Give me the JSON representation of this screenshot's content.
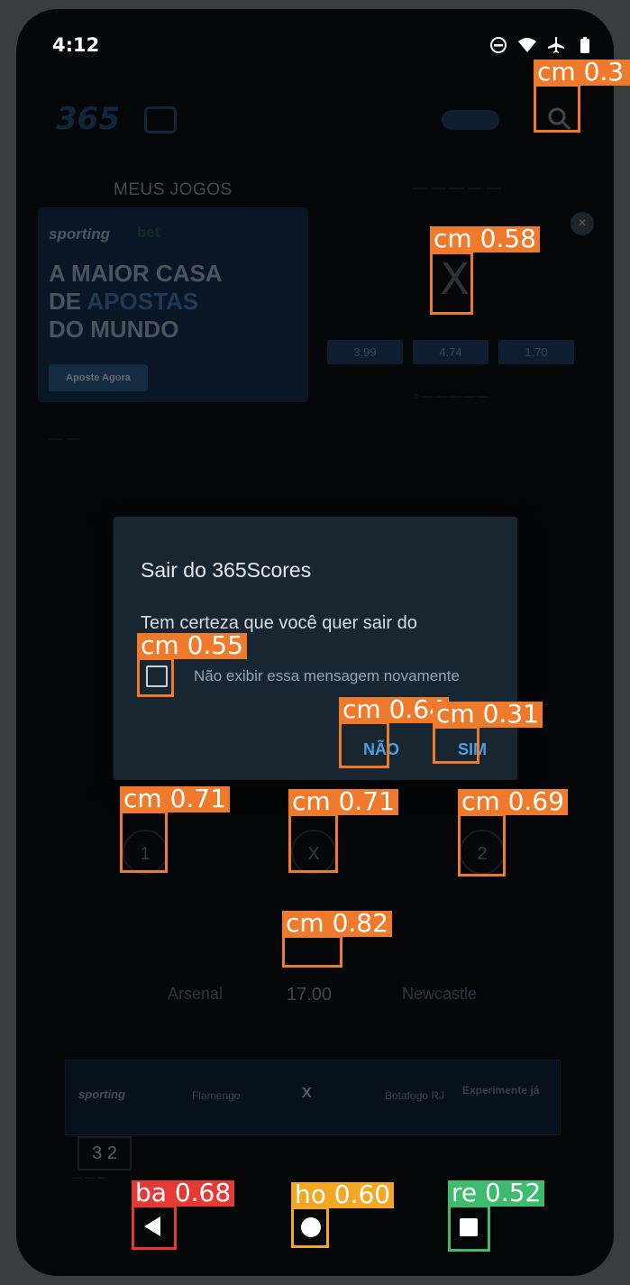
{
  "status_bar": {
    "time": "4:12"
  },
  "app": {
    "logo": "365",
    "tab_my_games": "MEUS JOGOS",
    "banner": {
      "brand": "sporting",
      "brand_suffix": "bet",
      "headline_line1": "A MAIOR CASA",
      "headline_line2a": "DE ",
      "headline_line2b": "APOSTAS",
      "headline_line3": "DO MUNDO",
      "cta": "Aposte Agora"
    },
    "close_ad": "×",
    "odds_x": "X",
    "odds": [
      "3.99",
      "4.74",
      "1.70"
    ],
    "prediction": {
      "home": "1",
      "draw": "X",
      "away": "2"
    },
    "match": {
      "home": "Arsenal",
      "away": "Newcastle",
      "time": "17.00"
    },
    "ad2": {
      "brand": "sporting",
      "home": "Flamengo",
      "vs": "X",
      "away": "Botafogo RJ",
      "cta": "Experimente já"
    },
    "score": "3 2"
  },
  "dialog": {
    "title": "Sair do 365Scores",
    "message": "Tem certeza que você quer sair do 365Scores?",
    "checkbox_label": "Não exibir essa mensagem novamente",
    "no_button": "NÃO",
    "yes_button": "SIM"
  },
  "detections": [
    {
      "label": "cm 0.3",
      "color": "#f07a2c"
    },
    {
      "label": "cm 0.58",
      "color": "#f07a2c"
    },
    {
      "label": "cm 0.55",
      "color": "#f07a2c"
    },
    {
      "label": "cm 0.64",
      "color": "#f07a2c"
    },
    {
      "label": "cm 0.31",
      "color": "#f07a2c"
    },
    {
      "label": "cm 0.71",
      "color": "#f07a2c"
    },
    {
      "label": "cm 0.71",
      "color": "#f07a2c"
    },
    {
      "label": "cm 0.69",
      "color": "#f07a2c"
    },
    {
      "label": "cm 0.82",
      "color": "#f07a2c"
    },
    {
      "label": "ba 0.68",
      "color": "#e53935"
    },
    {
      "label": "ho 0.60",
      "color": "#f5a623"
    },
    {
      "label": "re 0.52",
      "color": "#3dbb6e"
    }
  ]
}
